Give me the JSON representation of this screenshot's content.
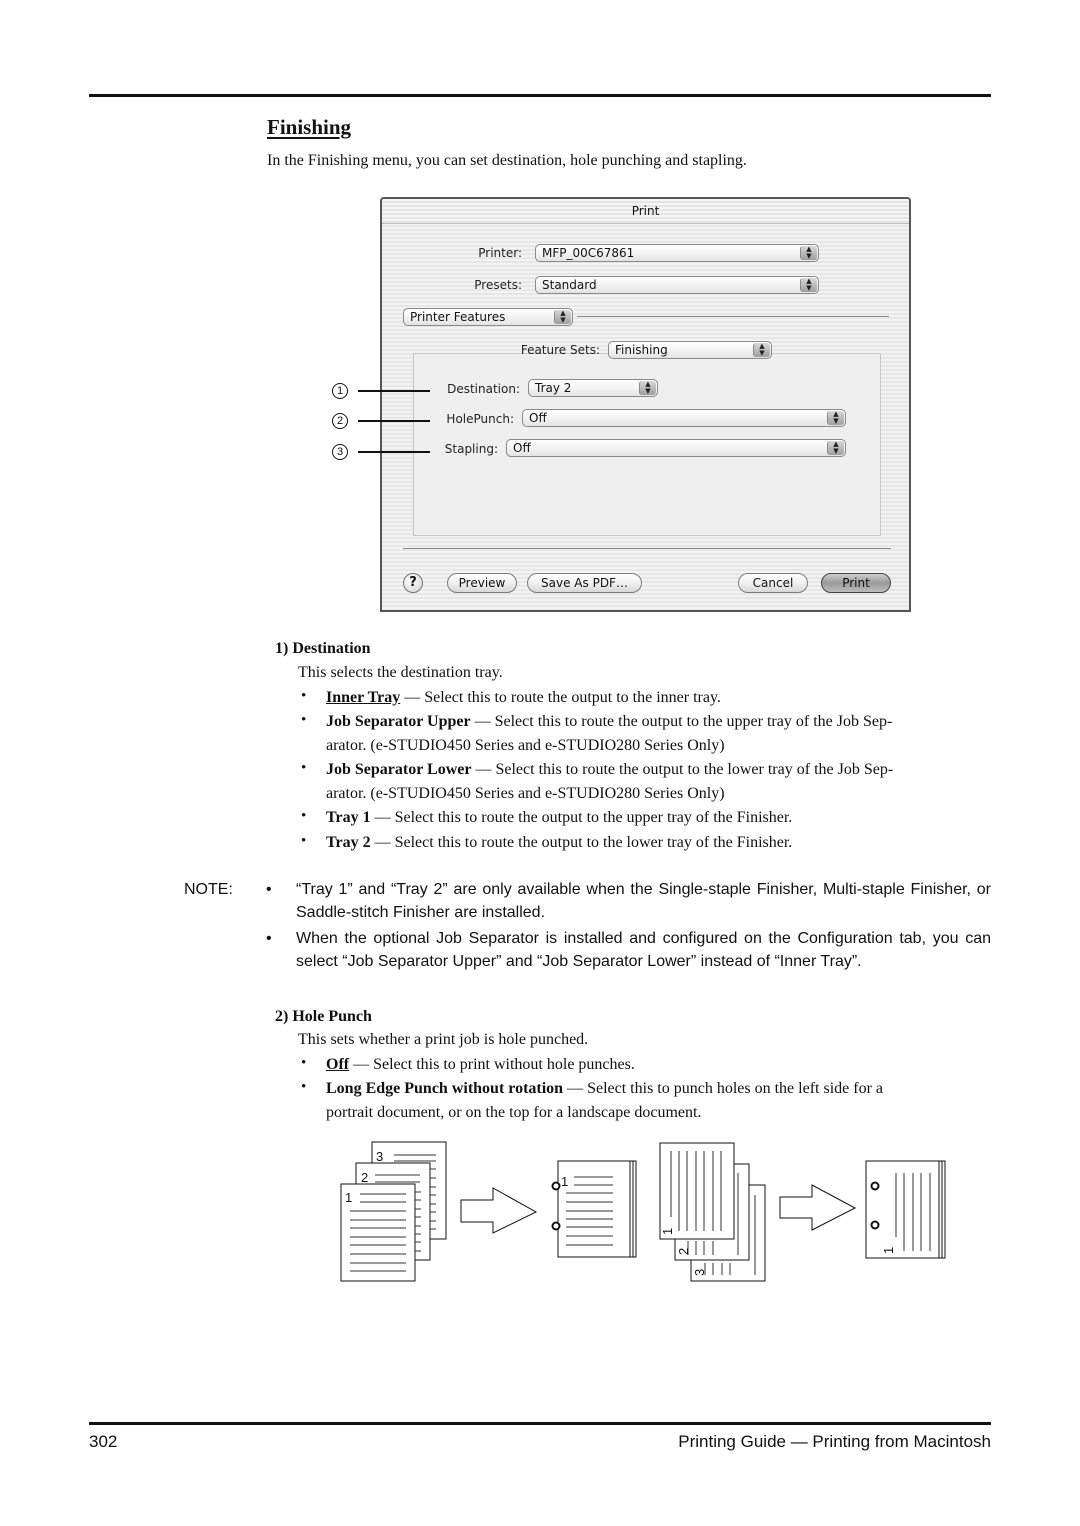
{
  "section": {
    "title": "Finishing",
    "intro": "In the Finishing menu, you can set destination, hole punching and stapling."
  },
  "dialog": {
    "title": "Print",
    "printer": {
      "label": "Printer:",
      "value": "MFP_00C67861"
    },
    "presets": {
      "label": "Presets:",
      "value": "Standard"
    },
    "pane": {
      "value": "Printer Features"
    },
    "feature_sets": {
      "label": "Feature Sets:",
      "value": "Finishing"
    },
    "destination": {
      "label": "Destination:",
      "value": "Tray 2"
    },
    "holepunch": {
      "label": "HolePunch:",
      "value": "Off"
    },
    "stapling": {
      "label": "Stapling:",
      "value": "Off"
    },
    "buttons": {
      "help": "?",
      "preview": "Preview",
      "save_pdf": "Save As PDF…",
      "cancel": "Cancel",
      "print": "Print"
    },
    "popup_arrows": "▲▼"
  },
  "callouts": [
    "1",
    "2",
    "3"
  ],
  "destination_section": {
    "heading": "1) Destination",
    "description": "This selects the destination tray.",
    "items": [
      {
        "term": "Inner Tray",
        "default": true,
        "text": " — Select this to route the output to the inner tray."
      },
      {
        "term": "Job Separator Upper",
        "default": false,
        "text": " — Select this to route the output to the upper tray of the Job Sep-",
        "text2": "arator. (e-STUDIO450 Series and e-STUDIO280 Series Only)"
      },
      {
        "term": "Job Separator Lower",
        "default": false,
        "text": " — Select this to route the output to the lower tray of the Job Sep-",
        "text2": "arator. (e-STUDIO450 Series and e-STUDIO280 Series Only)"
      },
      {
        "term": "Tray 1",
        "default": false,
        "text": " — Select this to route the output to the upper tray of the Finisher."
      },
      {
        "term": "Tray 2",
        "default": false,
        "text": " — Select this to route the output to the lower tray of the Finisher."
      }
    ]
  },
  "note": {
    "label": "NOTE:",
    "items": [
      "“Tray 1” and “Tray 2” are only available when the Single-staple Finisher, Multi-staple Finisher, or Saddle-stitch Finisher are installed.",
      "When the optional Job Separator is installed and configured on the Configuration tab, you can select “Job Separator Upper” and “Job Separator Lower” instead of “Inner Tray”."
    ]
  },
  "holepunch_section": {
    "heading": "2) Hole Punch",
    "description": "This sets whether a print job is hole punched.",
    "items": [
      {
        "term": "Off",
        "default": true,
        "text": " — Select this to print without hole punches."
      },
      {
        "term": "Long Edge Punch without rotation",
        "default": false,
        "text": " — Select this to punch holes on the left side for a",
        "text2": "portrait document, or on the top for a landscape document."
      }
    ]
  },
  "illustration": {
    "portrait_pages": [
      "1",
      "2",
      "3"
    ],
    "portrait_result": "1",
    "landscape_pages": [
      "1",
      "2",
      "3"
    ],
    "landscape_result": "1"
  },
  "footer": {
    "page_number": "302",
    "title": "Printing Guide — Printing from Macintosh"
  }
}
